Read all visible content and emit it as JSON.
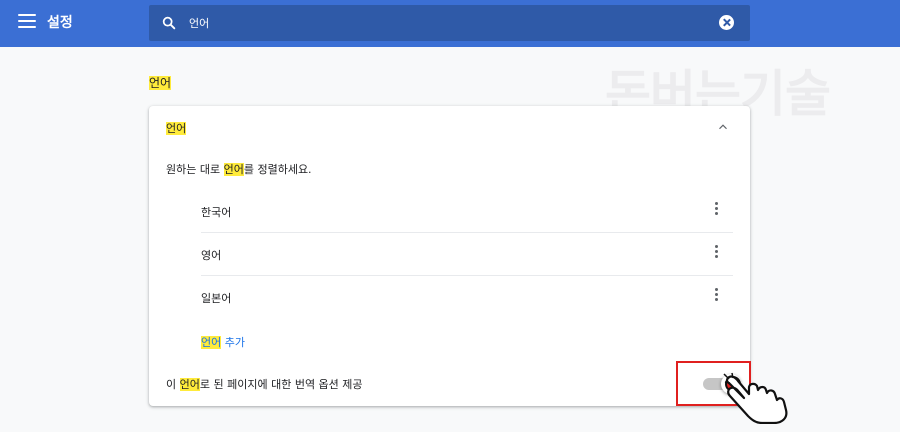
{
  "header": {
    "title": "설정",
    "search_value": "언어",
    "bg_color": "#3b6fd4"
  },
  "watermark": "돈버는기술",
  "section": {
    "title": "언어"
  },
  "card": {
    "header_label": "언어",
    "description_prefix": "원하는 대로 ",
    "description_highlight": "언어",
    "description_suffix": "를 정렬하세요.",
    "languages": [
      {
        "name": "한국어"
      },
      {
        "name": "영어"
      },
      {
        "name": "일본어"
      }
    ],
    "add_language_highlight": "언어",
    "add_language_suffix": " 추가",
    "offer_prefix": "이 ",
    "offer_highlight": "언어",
    "offer_suffix": "로 된 페이지에 대한 번역 옵션 제공",
    "offer_toggle_on": false
  },
  "colors": {
    "accent": "#3b6fd4",
    "highlight": "#ffeb3b",
    "annotation": "#e0201f",
    "link": "#1a73e8"
  },
  "icons": {
    "menu": "menu-icon",
    "search": "search-icon",
    "clear": "clear-icon",
    "collapse": "chevron-up-icon",
    "more": "more-vert-icon",
    "cursor": "hand-pointer-icon"
  }
}
